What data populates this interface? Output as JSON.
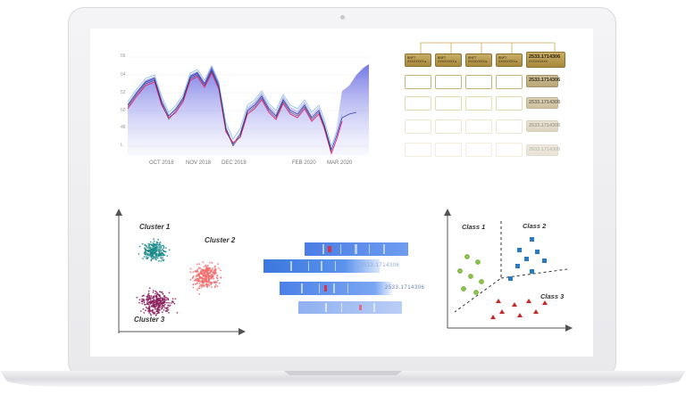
{
  "timeseries": {
    "y_ticks": [
      "56",
      "54",
      "52",
      "50",
      "48",
      "L"
    ],
    "x_ticks": [
      "OCT 2018",
      "NOV 2018",
      "DEC 2018",
      "FEB 2020",
      "MAR 2020"
    ]
  },
  "tree": {
    "top_row": [
      {
        "title": "BNFT",
        "sub": "XXXXXXXX ▸"
      },
      {
        "title": "BNFT",
        "sub": "XXXXXXXX ▸"
      },
      {
        "title": "BNFT",
        "sub": "XXXXXXXX ▸"
      },
      {
        "title": "BNFT",
        "sub": "XXXXXXXX ▸"
      }
    ],
    "highlight": {
      "title": "2533.1714306",
      "sub": "XXXXXXXXX"
    },
    "side_values": [
      "2533.1714306",
      "2533.1714306",
      "2533.1714306",
      "2533.1714306"
    ]
  },
  "clusters": {
    "labels": [
      "Cluster 1",
      "Cluster 2",
      "Cluster 3"
    ],
    "colors": {
      "cluster1": "#1a8a8a",
      "cluster2": "#f26b6b",
      "cluster3": "#8a1f5a"
    }
  },
  "heatstrips": {
    "values": [
      "2533.1714306",
      "2533.1714306"
    ]
  },
  "classes": {
    "labels": [
      "Class 1",
      "Class 2",
      "Class 3"
    ],
    "colors": {
      "class1": "#8bc34a",
      "class2": "#2a7ac0",
      "class3": "#c62828"
    }
  }
}
